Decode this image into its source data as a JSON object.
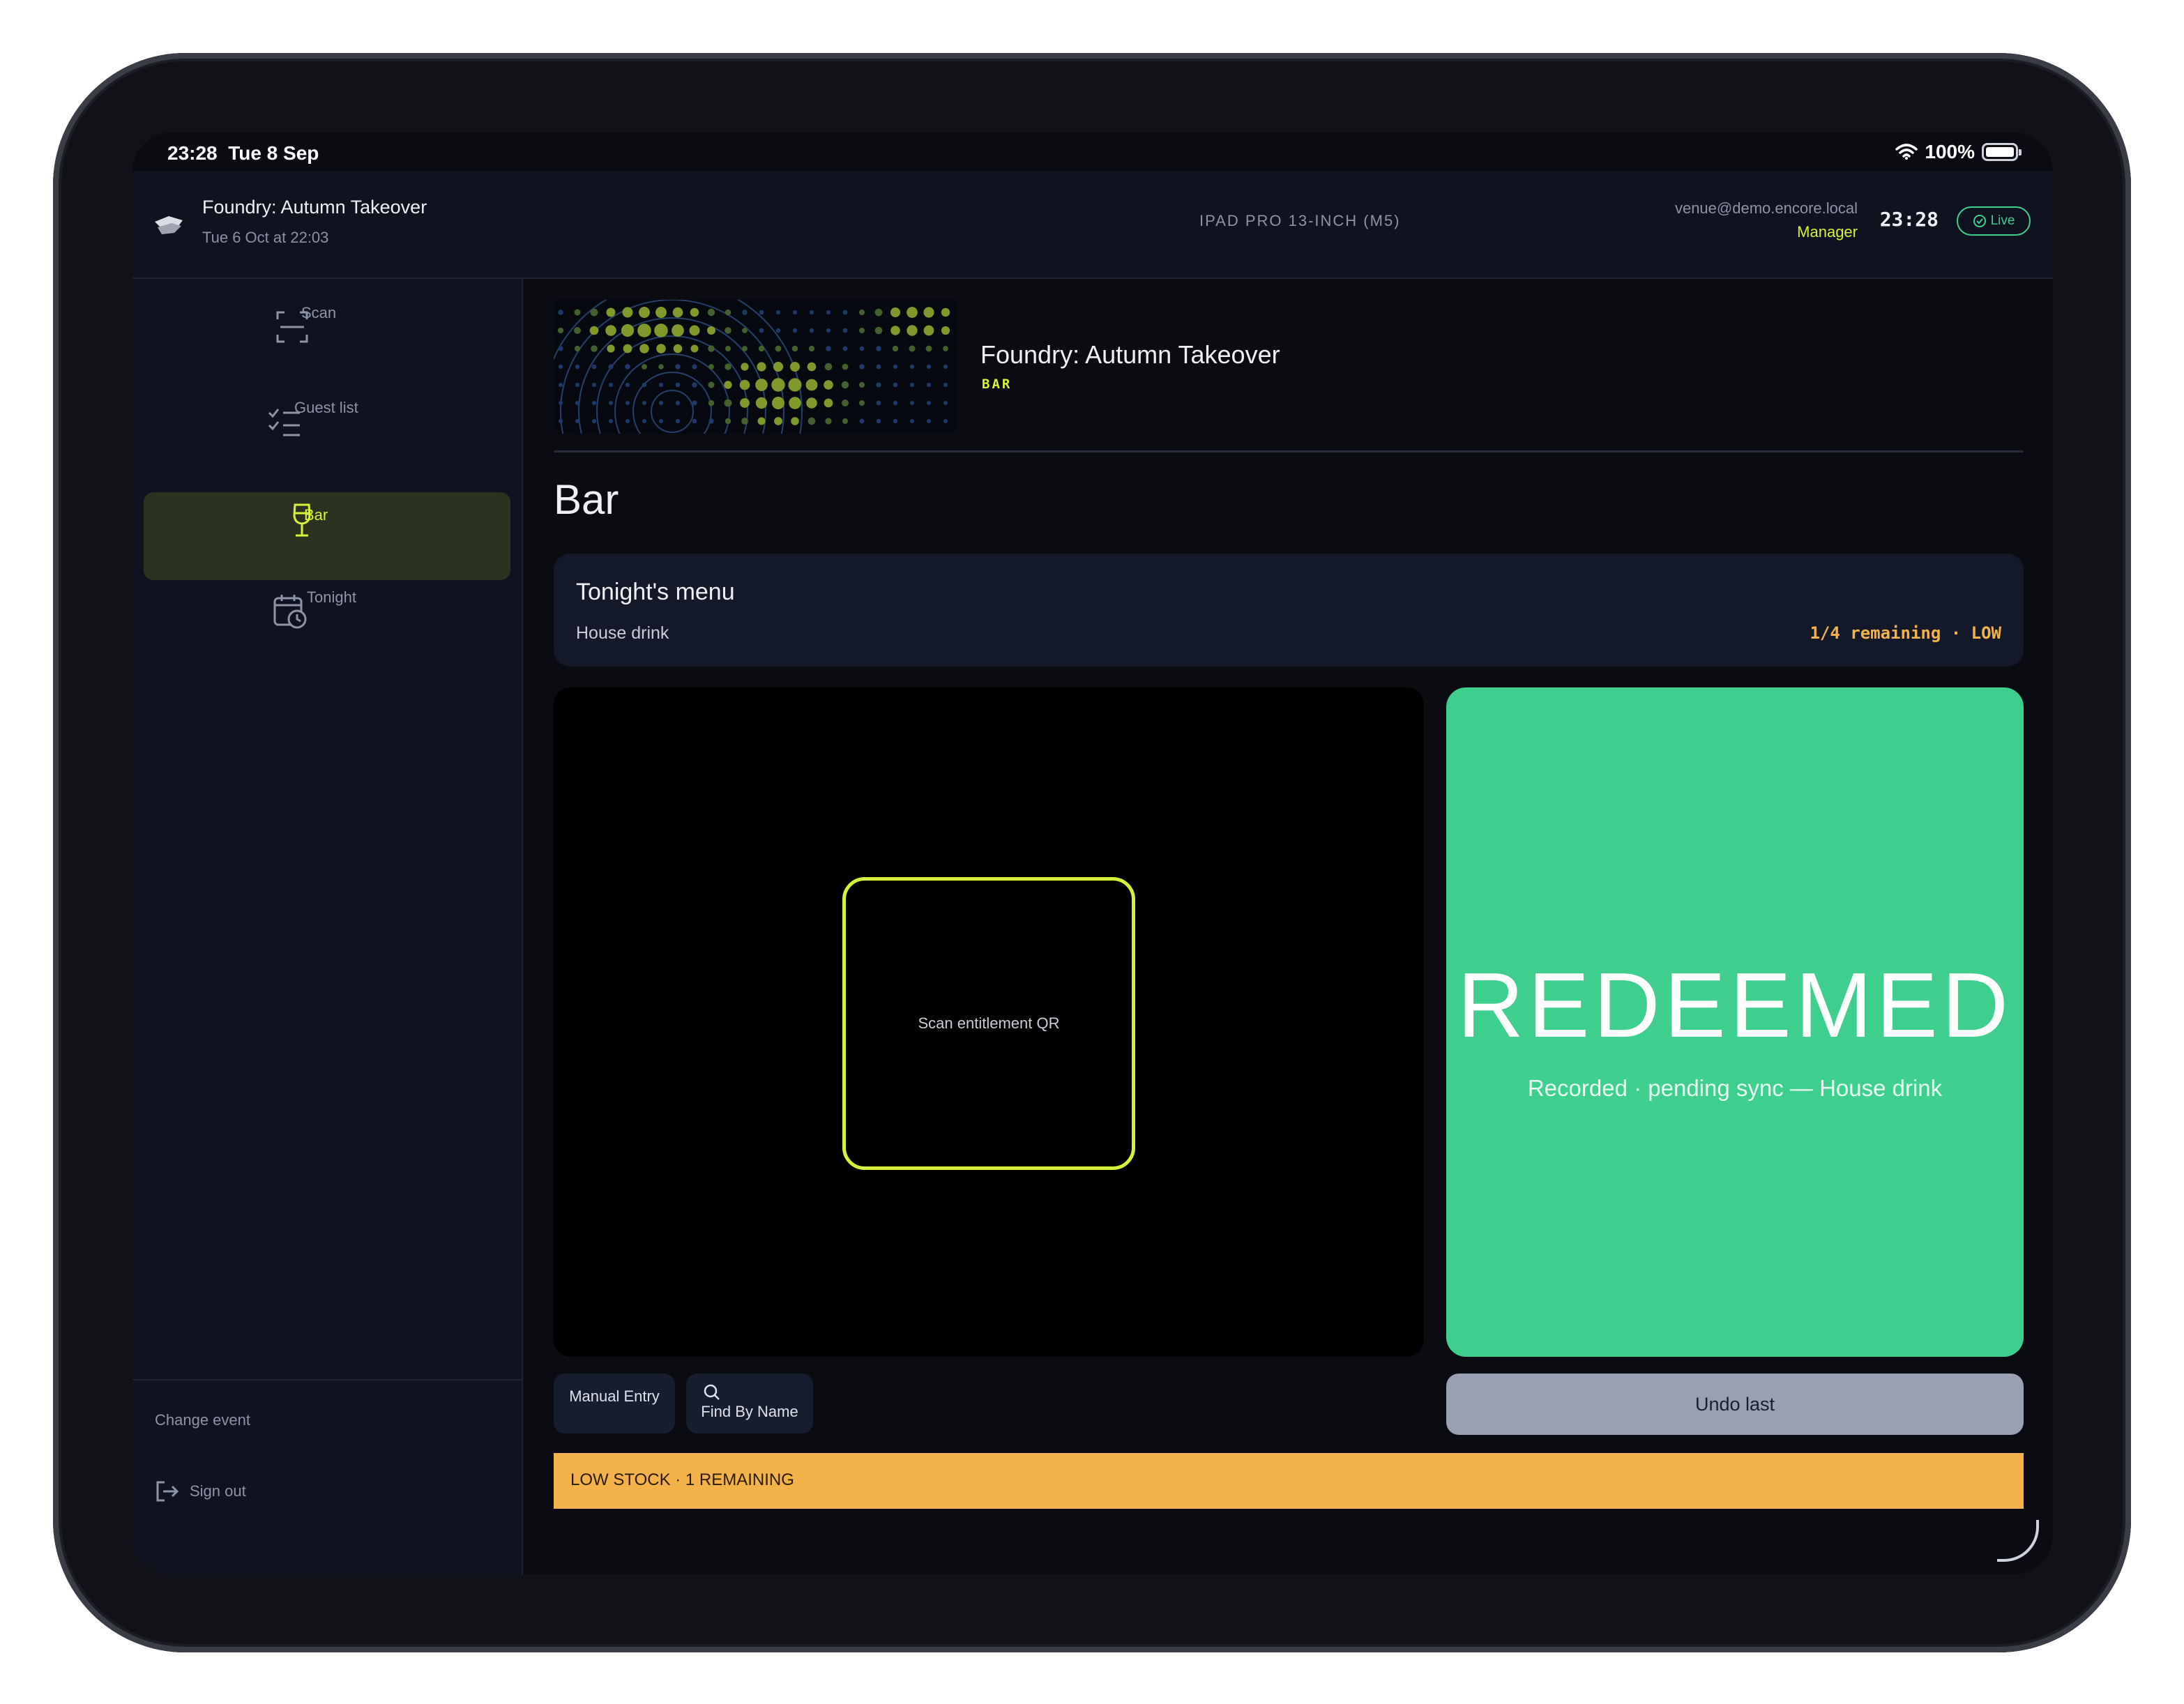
{
  "status_bar": {
    "time": "23:28",
    "date": "Tue 8 Sep",
    "battery": "100%"
  },
  "topbar": {
    "event_title": "Foundry: Autumn Takeover",
    "event_datetime": "Tue 6 Oct at 22:03",
    "device_label": "IPAD PRO 13-INCH (M5)",
    "user_email": "venue@demo.encore.local",
    "user_role": "Manager",
    "clock": "23:28",
    "live_label": "Live"
  },
  "sidebar": {
    "items": [
      {
        "label": "Scan",
        "icon": "scan-icon"
      },
      {
        "label": "Guest list",
        "icon": "checklist-icon"
      },
      {
        "label": "Bar",
        "icon": "wine-glass-icon",
        "active": true
      },
      {
        "label": "Tonight",
        "icon": "calendar-clock-icon"
      }
    ],
    "change_event": "Change event",
    "sign_out": "Sign out"
  },
  "hero": {
    "title": "Foundry: Autumn Takeover",
    "tag": "BAR"
  },
  "page": {
    "title": "Bar"
  },
  "menu": {
    "title": "Tonight's menu",
    "item": "House drink",
    "stock": "1/4 remaining · LOW"
  },
  "scanner": {
    "label": "Scan entitlement QR"
  },
  "result": {
    "title": "REDEEMED",
    "subtitle": "Recorded · pending sync — House drink"
  },
  "actions": {
    "manual_entry": "Manual Entry",
    "find_by_name": "Find By Name",
    "undo": "Undo last"
  },
  "alert": {
    "text": "LOW STOCK · 1 REMAINING"
  },
  "colors": {
    "accent": "#d7f03a",
    "success": "#3ecf8e",
    "warning": "#f3b34a",
    "surface": "#0f1320"
  }
}
